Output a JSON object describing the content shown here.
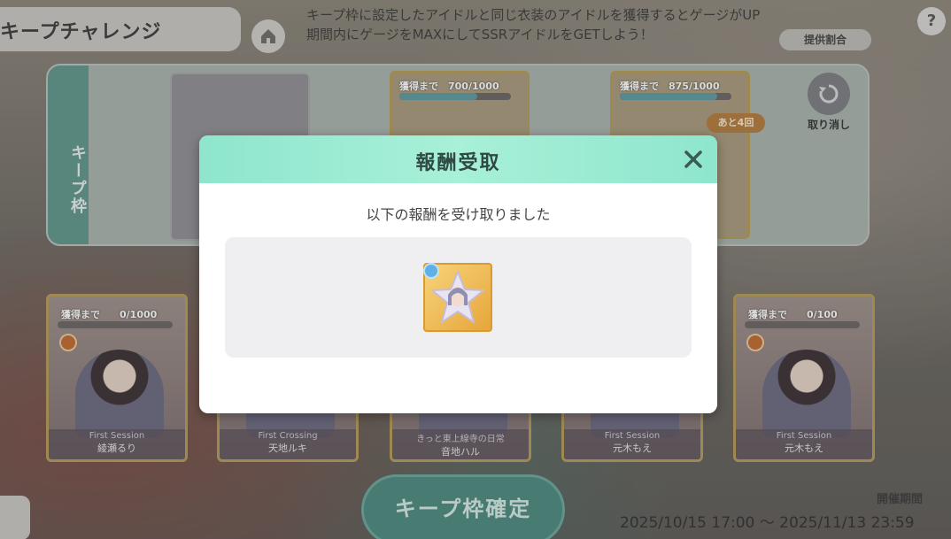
{
  "header": {
    "title": "キープチャレンジ",
    "info_line1": "キープ枠に設定したアイドルと同じ衣装のアイドルを獲得するとゲージがUP",
    "info_line2": "期間内にゲージをMAXにしてSSRアイドルをGETしよう！",
    "rate_button": "提供割合",
    "help_button": "?"
  },
  "keep_panel": {
    "tab_label": "キープ枠",
    "slots": [
      {
        "progress_label": "獲得まで　700/1000",
        "progress": 0.7
      },
      {
        "progress_label": "獲得まで　875/1000",
        "progress": 0.875,
        "badge": "あと4回"
      }
    ],
    "undo_label": "取り消し"
  },
  "idols": [
    {
      "progress_label": "獲得まで　　0/1000",
      "subtitle": "First Session",
      "name": "綾瀬るり"
    },
    {
      "progress_label": "",
      "subtitle": "First Crossing",
      "name": "天地ルキ"
    },
    {
      "progress_label": "",
      "subtitle": "きっと東上線寺の日常",
      "name": "音地ハル"
    },
    {
      "progress_label": "",
      "subtitle": "First Session",
      "name": "元木もえ"
    },
    {
      "progress_label": "獲得まで　　0/100",
      "subtitle": "First Session",
      "name": "元木もえ"
    }
  ],
  "confirm_button": "キープ枠確定",
  "period": {
    "label": "開催期間",
    "range": "2025/10/15 17:00 ～ 2025/11/13 23:59"
  },
  "modal": {
    "title": "報酬受取",
    "message": "以下の報酬を受け取りました"
  },
  "colors": {
    "modal_header": "#8ee6cd",
    "confirm_button": "#4b8a7f",
    "keep_tab": "#5f958a"
  }
}
